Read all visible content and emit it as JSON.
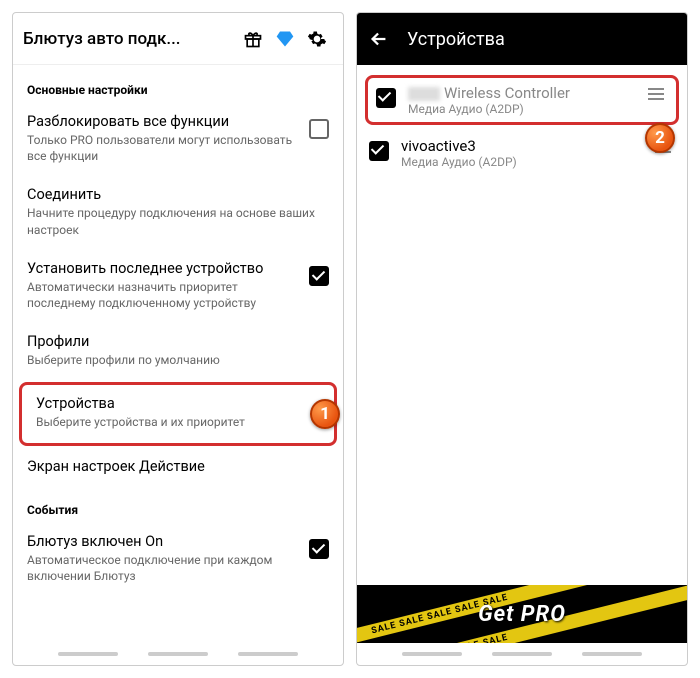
{
  "left": {
    "appbar": {
      "title": "Блютуз авто подк..."
    },
    "sections": {
      "main_header": "Основные настройки",
      "events_header": "События"
    },
    "settings": {
      "unlock": {
        "title": "Разблокировать все функции",
        "sub": "Только PRO пользователи могут использовать все функции"
      },
      "connect": {
        "title": "Соединить",
        "sub": "Начните процедуру подключения на основе ваших настроек"
      },
      "lastdev": {
        "title": "Установить последнее устройство",
        "sub": "Автоматически назначить приоритет последнему подключенному устройству"
      },
      "profiles": {
        "title": "Профили",
        "sub": "Выберите профили по умолчанию"
      },
      "devices": {
        "title": "Устройства",
        "sub": "Выберите устройства и их приоритет"
      },
      "screen": {
        "title": "Экран настроек Действие"
      },
      "bton": {
        "title": "Блютуз включен On",
        "sub": "Автоматическое подключение при каждом включении Блютуз"
      }
    }
  },
  "right": {
    "appbar": {
      "title": "Устройства"
    },
    "devices": [
      {
        "name": "Wireless Controller",
        "sub": "Медиа Аудио (A2DP)"
      },
      {
        "name": "vivoactive3",
        "sub": "Медиа Аудио (A2DP)"
      }
    ],
    "promo": "Get PRO"
  },
  "badges": {
    "one": "1",
    "two": "2"
  }
}
